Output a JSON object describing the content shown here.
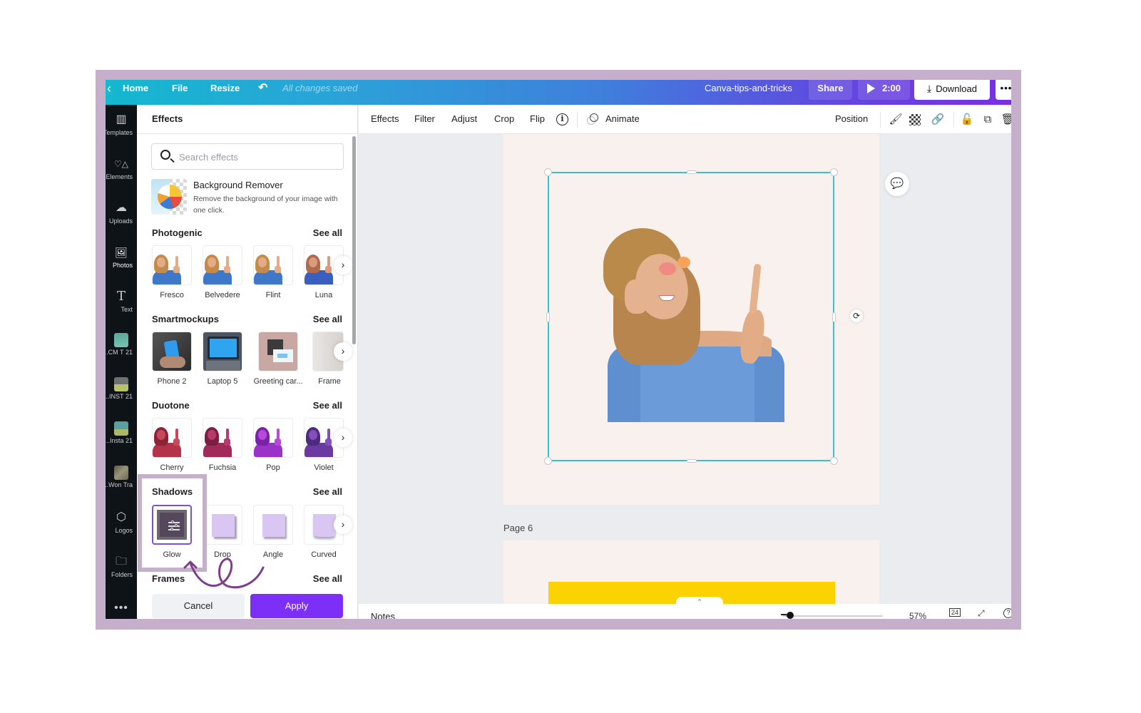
{
  "topbar": {
    "back": "‹",
    "home": "Home",
    "file": "File",
    "resize": "Resize",
    "undo": "↶",
    "status": "All changes saved",
    "doc_title": "Canva-tips-and-tricks",
    "share": "Share",
    "play_time": "2:00",
    "download": "Download",
    "download_icon": "⤓",
    "more": "•••"
  },
  "rail": {
    "items": [
      {
        "label": "Templates",
        "icon": "▥"
      },
      {
        "label": "Elements",
        "icon": "♡△"
      },
      {
        "label": "Uploads",
        "icon": "☁"
      },
      {
        "label": "Photos",
        "icon": "🖼"
      },
      {
        "label": "Text",
        "icon": "T"
      },
      {
        "label": "21 CM T...",
        "color": "#5aa89a"
      },
      {
        "label": "21 INST...",
        "color": "#6f7b72"
      },
      {
        "label": "21 Insta...",
        "color": "#5aa0a0"
      },
      {
        "label": "Won Tra...",
        "color": "#7c7663"
      },
      {
        "label": "Logos",
        "icon": "⬡"
      },
      {
        "label": "Folders",
        "icon": "🗀"
      }
    ],
    "more": "•••"
  },
  "panel": {
    "title": "Effects",
    "search_placeholder": "Search effects",
    "bg_remover": {
      "title": "Background Remover",
      "desc": "Remove the background of your image with one click."
    },
    "see_all": "See all",
    "sections": {
      "photogenic": {
        "title": "Photogenic",
        "items": [
          "Fresco",
          "Belvedere",
          "Flint",
          "Luna"
        ]
      },
      "smartmockups": {
        "title": "Smartmockups",
        "items": [
          "Phone 2",
          "Laptop 5",
          "Greeting car...",
          "Frame"
        ]
      },
      "duotone": {
        "title": "Duotone",
        "items": [
          "Cherry",
          "Fuchsia",
          "Pop",
          "Violet"
        ]
      },
      "shadows": {
        "title": "Shadows",
        "items": [
          "Glow",
          "Drop",
          "Angle",
          "Curved"
        ]
      },
      "frames": {
        "title": "Frames"
      }
    },
    "next": "›",
    "cancel": "Cancel",
    "apply": "Apply"
  },
  "toolbar": {
    "effects": "Effects",
    "filter": "Filter",
    "adjust": "Adjust",
    "crop": "Crop",
    "flip": "Flip",
    "info": "i",
    "animate": "Animate",
    "position": "Position"
  },
  "canvas": {
    "page_label": "Page 6",
    "rotate": "⟳",
    "comment": "💬",
    "collapse": "⌃"
  },
  "bottombar": {
    "notes": "Notes",
    "zoom": "57%",
    "zoom_value_percent": 57,
    "page_count": "24",
    "expand": "⤢",
    "help": "?"
  },
  "colors": {
    "accent": "#7b2ff7",
    "selection": "#32c5cf",
    "annotation": "#c6afca"
  }
}
